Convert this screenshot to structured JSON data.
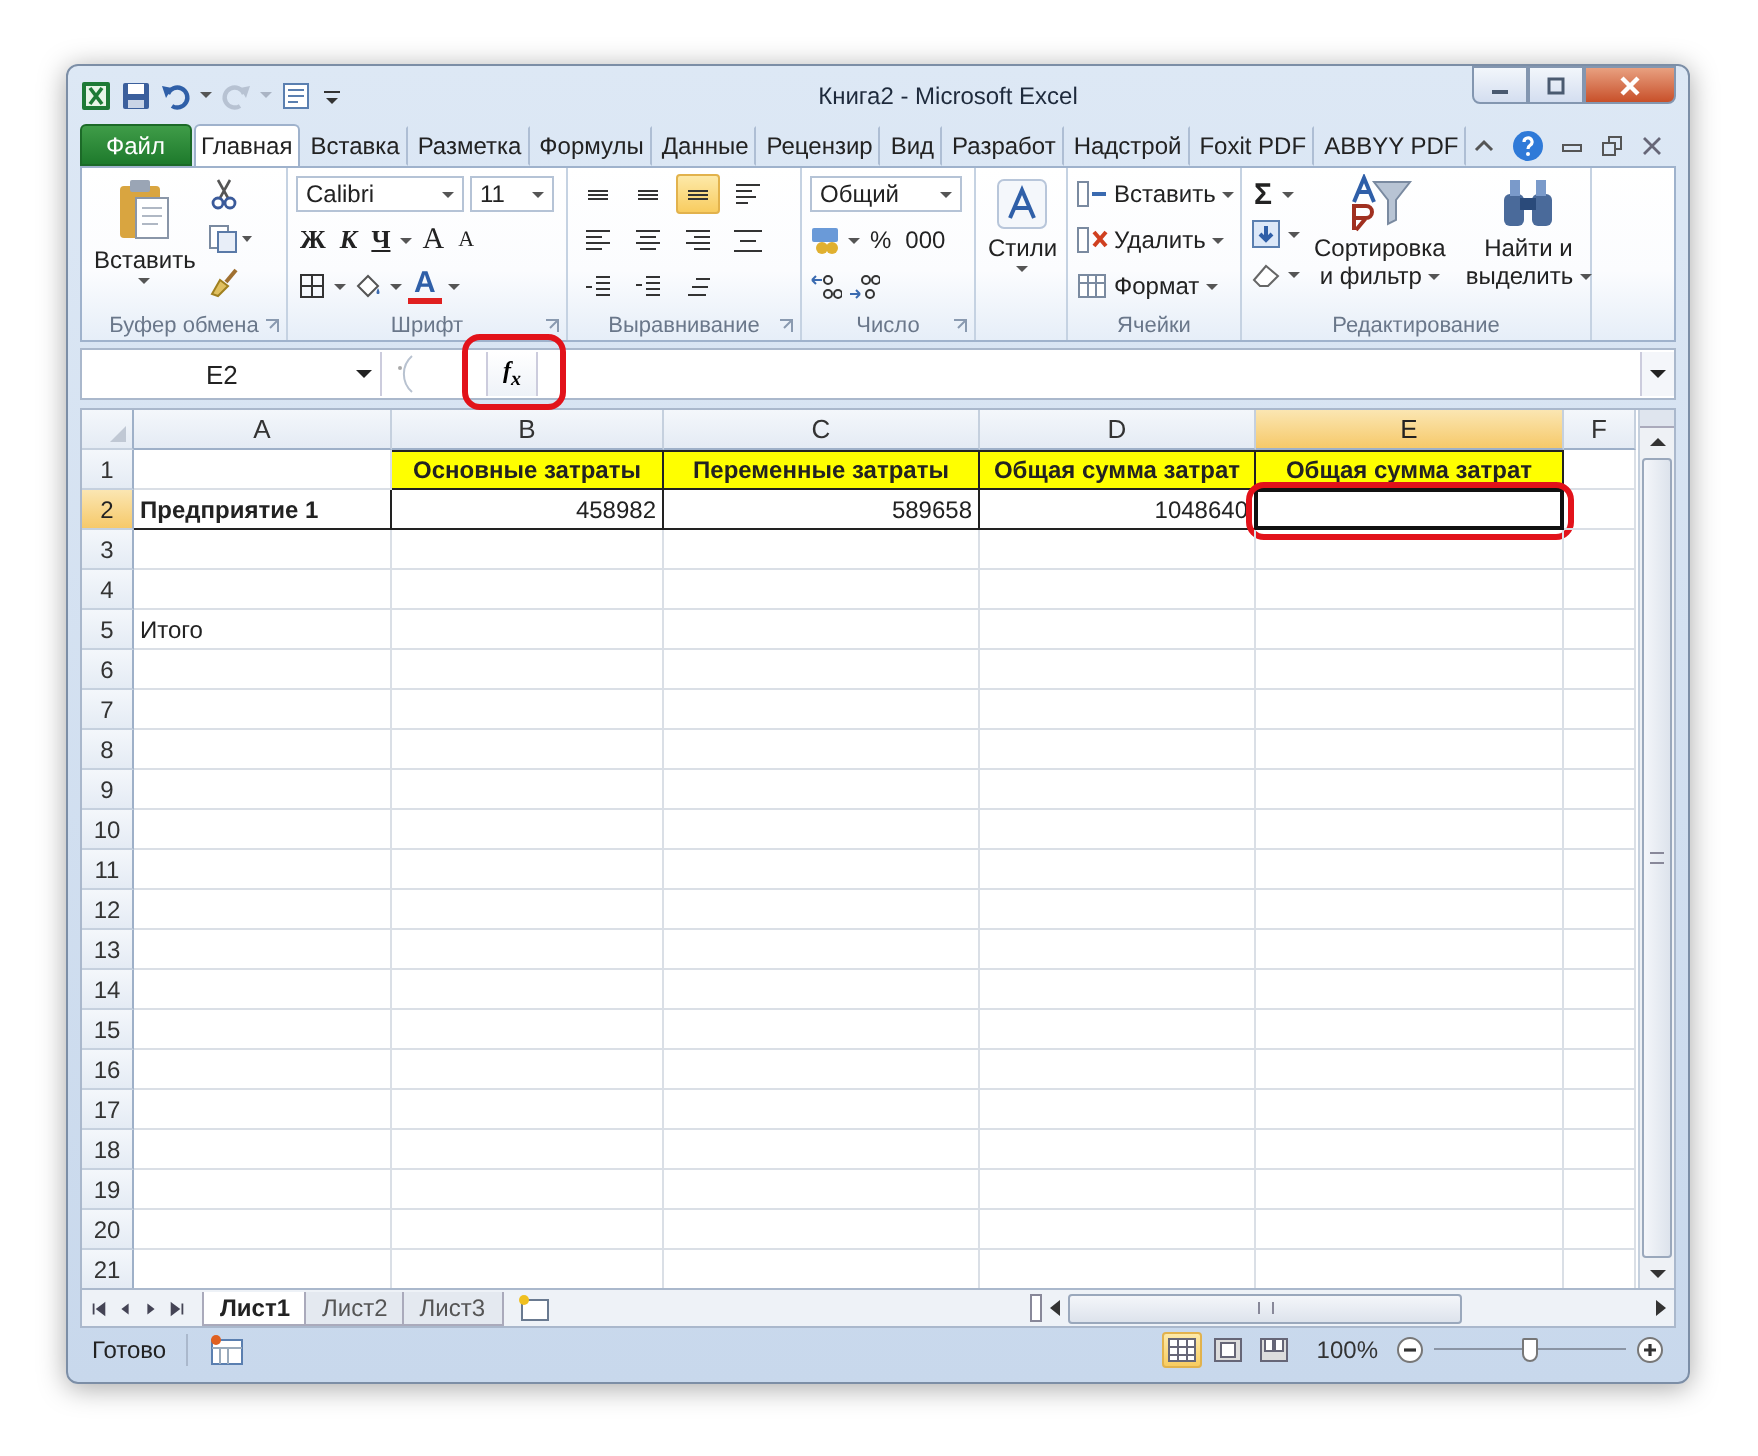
{
  "window": {
    "title": "Книга2 - Microsoft Excel"
  },
  "tabs": [
    {
      "label": "Файл",
      "kind": "file",
      "selected": false
    },
    {
      "label": "Главная",
      "kind": "tab",
      "selected": true
    },
    {
      "label": "Вставка",
      "kind": "tab",
      "selected": false
    },
    {
      "label": "Разметка",
      "kind": "tab",
      "selected": false
    },
    {
      "label": "Формулы",
      "kind": "tab",
      "selected": false
    },
    {
      "label": "Данные",
      "kind": "tab",
      "selected": false
    },
    {
      "label": "Рецензир",
      "kind": "tab",
      "selected": false
    },
    {
      "label": "Вид",
      "kind": "tab",
      "selected": false
    },
    {
      "label": "Разработ",
      "kind": "tab",
      "selected": false
    },
    {
      "label": "Надстрой",
      "kind": "tab",
      "selected": false
    },
    {
      "label": "Foxit PDF",
      "kind": "tab",
      "selected": false
    },
    {
      "label": "ABBYY PDF",
      "kind": "tab",
      "selected": false
    }
  ],
  "ribbon": {
    "clipboard": {
      "label": "Буфер обмена",
      "paste": "Вставить"
    },
    "font": {
      "label": "Шрифт",
      "font_name": "Calibri",
      "font_size": "11",
      "bold": "Ж",
      "italic": "К",
      "underline": "Ч",
      "grow": "A",
      "shrink": "A",
      "font_color": "A"
    },
    "alignment": {
      "label": "Выравнивание",
      "buttons": [
        {
          "kind": "top",
          "selected": false
        },
        {
          "kind": "middle",
          "selected": false
        },
        {
          "kind": "bottom",
          "selected": true
        },
        {
          "kind": "wrap",
          "selected": false
        },
        {
          "kind": "left",
          "selected": false
        },
        {
          "kind": "center",
          "selected": false
        },
        {
          "kind": "right",
          "selected": false
        },
        {
          "kind": "merge",
          "selected": false
        },
        {
          "kind": "outdent",
          "selected": false
        },
        {
          "kind": "indent",
          "selected": false
        },
        {
          "kind": "orientation",
          "selected": false
        }
      ]
    },
    "number": {
      "label": "Число",
      "format": "Общий",
      "percent": "%",
      "thousands": "000"
    },
    "styles": {
      "label": "Стили"
    },
    "cells": {
      "label": "Ячейки",
      "insert": "Вставить",
      "delete": "Удалить",
      "format": "Формат"
    },
    "editing": {
      "label": "Редактирование",
      "sum": "Σ",
      "sort": [
        "Сортировка",
        "и фильтр"
      ],
      "find": [
        "Найти и",
        "выделить"
      ]
    }
  },
  "formula_bar": {
    "name_box": "E2",
    "function_label": "f$_{x}$",
    "function_highlighted": true
  },
  "sheet": {
    "active_cell_highlighted": true,
    "columns": [
      {
        "label": "A",
        "selected": false
      },
      {
        "label": "B",
        "selected": false
      },
      {
        "label": "C",
        "selected": false
      },
      {
        "label": "D",
        "selected": false
      },
      {
        "label": "E",
        "selected": true
      },
      {
        "label": "F",
        "selected": false
      }
    ],
    "rows": [
      {
        "number": "1",
        "selected": false,
        "cells": [
          {
            "kind": "empty",
            "text": ""
          },
          {
            "kind": "header",
            "text": "Основные затраты"
          },
          {
            "kind": "header",
            "text": "Переменные затраты"
          },
          {
            "kind": "header",
            "text": "Общая сумма затрат"
          },
          {
            "kind": "header",
            "text": "Общая сумма затрат"
          },
          {
            "kind": "empty",
            "text": ""
          }
        ]
      },
      {
        "number": "2",
        "selected": true,
        "cells": [
          {
            "kind": "label",
            "text": "Предприятие 1"
          },
          {
            "kind": "number",
            "text": "458982"
          },
          {
            "kind": "number",
            "text": "589658"
          },
          {
            "kind": "number",
            "text": "1048640"
          },
          {
            "kind": "boxed",
            "text": ""
          },
          {
            "kind": "empty",
            "text": ""
          }
        ]
      },
      {
        "number": "3",
        "selected": false
      },
      {
        "number": "4",
        "selected": false
      },
      {
        "number": "5",
        "selected": false,
        "cells": [
          {
            "kind": "text",
            "text": "Итого"
          },
          {
            "kind": "empty",
            "text": ""
          },
          {
            "kind": "empty",
            "text": ""
          },
          {
            "kind": "empty",
            "text": ""
          },
          {
            "kind": "empty",
            "text": ""
          },
          {
            "kind": "empty",
            "text": ""
          }
        ]
      },
      {
        "number": "6",
        "selected": false
      },
      {
        "number": "7",
        "selected": false
      },
      {
        "number": "8",
        "selected": false
      },
      {
        "number": "9",
        "selected": false
      },
      {
        "number": "10",
        "selected": false
      },
      {
        "number": "11",
        "selected": false
      },
      {
        "number": "12",
        "selected": false
      },
      {
        "number": "13",
        "selected": false
      },
      {
        "number": "14",
        "selected": false
      },
      {
        "number": "15",
        "selected": false
      },
      {
        "number": "16",
        "selected": false
      },
      {
        "number": "17",
        "selected": false
      },
      {
        "number": "18",
        "selected": false
      },
      {
        "number": "19",
        "selected": false
      },
      {
        "number": "20",
        "selected": false
      },
      {
        "number": "21",
        "selected": false
      }
    ]
  },
  "sheet_tabs": [
    {
      "label": "Лист1",
      "selected": true
    },
    {
      "label": "Лист2",
      "selected": false
    },
    {
      "label": "Лист3",
      "selected": false
    }
  ],
  "status_bar": {
    "status": "Готово",
    "views": [
      {
        "kind": "normal",
        "selected": true
      },
      {
        "kind": "layout",
        "selected": false
      },
      {
        "kind": "pagebreak",
        "selected": false
      }
    ],
    "zoom": "100%",
    "zoom_slider": {
      "level": 0.5
    }
  }
}
